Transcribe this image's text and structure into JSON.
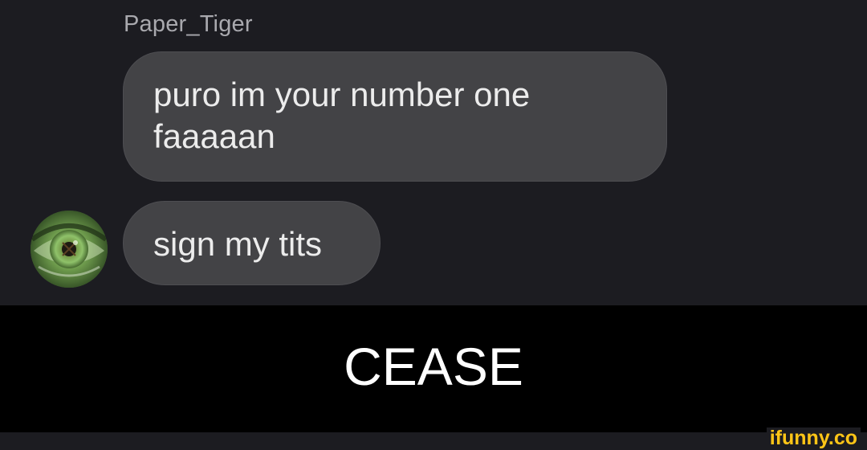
{
  "chat": {
    "sender_name": "Paper_Tiger",
    "messages": [
      {
        "text": "puro im your number one faaaaan"
      },
      {
        "text": "sign my tits"
      }
    ],
    "avatar_icon": "green-eye-avatar"
  },
  "caption": {
    "text": "CEASE"
  },
  "watermark": {
    "text": "ifunny.co",
    "color": "#ffc517"
  },
  "colors": {
    "background": "#1c1c21",
    "bubble": "#434346",
    "caption_bar": "#000000"
  }
}
